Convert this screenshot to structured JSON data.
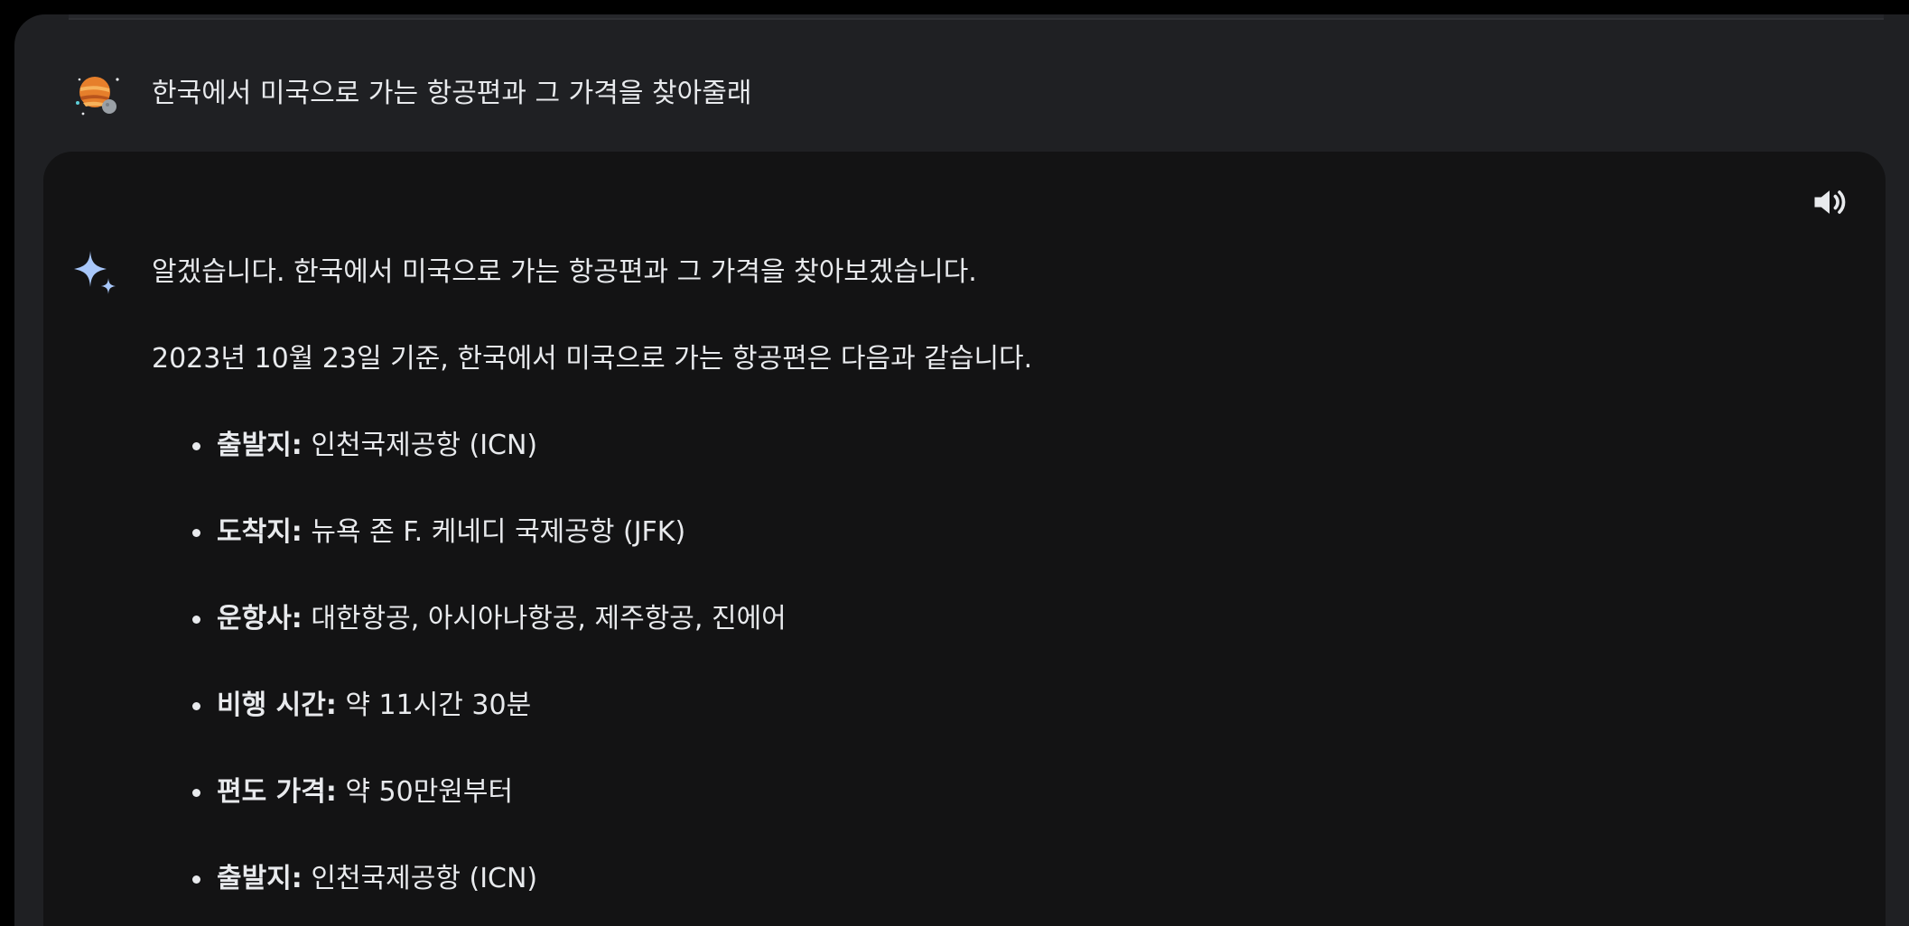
{
  "user_prompt": {
    "avatar_icon": "planet-avatar-icon",
    "text": "한국에서 미국으로 가는 항공편과 그 가격을 찾아줄래"
  },
  "response": {
    "assistant_icon": "sparkle-icon",
    "speaker_icon": "volume-icon",
    "intro": "알겠습니다. 한국에서 미국으로 가는 항공편과 그 가격을 찾아보겠습니다.",
    "date_line": "2023년 10월 23일 기준, 한국에서 미국으로 가는 항공편은 다음과 같습니다.",
    "bullets": [
      {
        "label": "출발지:",
        "value": " 인천국제공항 (ICN)"
      },
      {
        "label": "도착지:",
        "value": " 뉴욕 존 F. 케네디 국제공항 (JFK)"
      },
      {
        "label": "운항사:",
        "value": " 대한항공, 아시아나항공, 제주항공, 진에어"
      },
      {
        "label": "비행 시간:",
        "value": " 약 11시간 30분"
      },
      {
        "label": "편도 가격:",
        "value": " 약 50만원부터"
      },
      {
        "label": "출발지:",
        "value": " 인천국제공항 (ICN)"
      }
    ]
  },
  "colors": {
    "page_bg": "#000000",
    "panel_bg": "#1f2023",
    "card_bg": "#131314",
    "text": "#e8eaed",
    "accent_sparkle": "#a8c7fa"
  }
}
